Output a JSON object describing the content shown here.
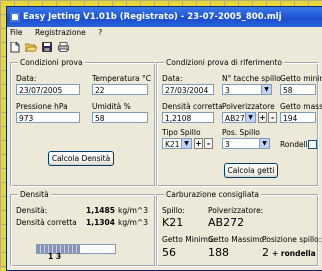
{
  "window": {
    "title": "Easy Jetting V1.01b (Registrato) - 23-07-2005_800.mlj"
  },
  "menu": [
    "File",
    "Registrazione",
    "?"
  ],
  "toolbar": {
    "icons": [
      "new-document-icon",
      "open-folder-icon",
      "save-icon",
      "print-icon"
    ]
  },
  "condizioni_prova": {
    "legend": "Condizioni prova",
    "data_label": "Data:",
    "data_value": "23/07/2005",
    "temp_label": "Temperatura °C",
    "temp_value": "22",
    "pressione_label": "Pressione  hPa",
    "pressione_value": "973",
    "umidita_label": "Umidità  %",
    "umidita_value": "58",
    "calcola_button": "Calcola Densità"
  },
  "condizioni_riferimento": {
    "legend": "Condizioni prova di riferimento",
    "data_label": "Data:",
    "data_value": "27/03/2004",
    "tacche_label": "N° tacche spillo",
    "tacche_value": "3",
    "getto_min_label": "Getto minimo",
    "getto_min_value": "58",
    "densita_label": "Densità corretta",
    "densita_value": "1,2108",
    "polverizzatore_label": "Polverizzatore",
    "polverizzatore_value": "AB272",
    "getto_max_label": "Getto massimo",
    "getto_max_value": "194",
    "tipo_spillo_label": "Tipo Spillo",
    "tipo_spillo_value": "K21",
    "pos_spillo_label": "Pos. Spillo",
    "pos_spillo_value": "3",
    "rondella_label": "Rondella",
    "plus": "+",
    "minus": "-",
    "calcola_button": "Calcola getti"
  },
  "densita": {
    "legend": "Densità",
    "densita_label": "Densità:",
    "densita_value": "1,1485",
    "densita_unit": "kg/m^3",
    "corretta_label": "Densità corretta",
    "corretta_value": "1,1304",
    "corretta_unit": "kg/m^3",
    "progress_label": "1 3",
    "progress_fraction": 0.55
  },
  "carburazione": {
    "legend": "Carburazione consigliata",
    "spillo_label": "Spillo:",
    "spillo_value": "K21",
    "polverizzatore_label": "Polverizzatore:",
    "polverizzatore_value": "AB272",
    "getto_min_label": "Getto Minimo:",
    "getto_min_value": "56",
    "getto_max_label": "Getto Massimo:",
    "getto_max_value": "188",
    "posizione_label": "Posizione spillo:",
    "posizione_value": "2",
    "posizione_extra": "+ rondella"
  }
}
